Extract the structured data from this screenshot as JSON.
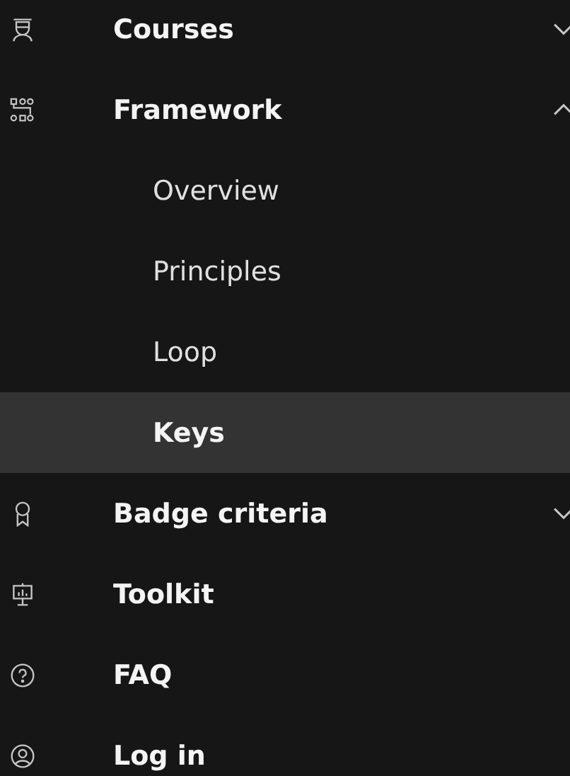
{
  "nav": [
    {
      "label": "Courses",
      "expanded": false
    },
    {
      "label": "Framework",
      "expanded": true,
      "children": [
        {
          "label": "Overview",
          "selected": false
        },
        {
          "label": "Principles",
          "selected": false
        },
        {
          "label": "Loop",
          "selected": false
        },
        {
          "label": "Keys",
          "selected": true
        }
      ]
    },
    {
      "label": "Badge criteria",
      "expanded": false
    },
    {
      "label": "Toolkit"
    },
    {
      "label": "FAQ"
    },
    {
      "label": "Log in"
    }
  ]
}
